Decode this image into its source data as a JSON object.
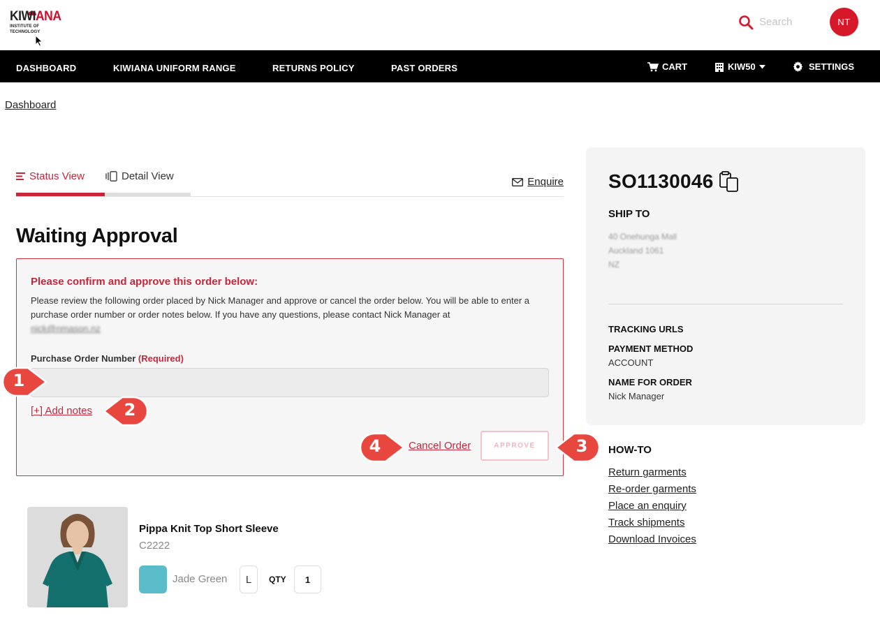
{
  "logo": {
    "brand_prefix": "KIWI",
    "brand_suffix": "ANA",
    "subtitle": "INSTITUTE OF TECHNOLOGY"
  },
  "header": {
    "search_placeholder": "Search",
    "avatar_initials": "NT"
  },
  "nav": {
    "items": [
      "DASHBOARD",
      "KIWIANA UNIFORM RANGE",
      "RETURNS POLICY",
      "PAST ORDERS"
    ],
    "cart": "CART",
    "account": "KIW50",
    "settings": "SETTINGS"
  },
  "breadcrumb": "Dashboard",
  "tabs": {
    "status": "Status View",
    "detail": "Detail View",
    "enquire": "Enquire"
  },
  "status_title": "Waiting Approval",
  "approval": {
    "heading": "Please confirm and approve this order below:",
    "body": "Please review the following order placed by Nick Manager and approve or cancel the order below. You will be able to enter a purchase order number or order notes below. If you have any questions, please contact Nick Manager at",
    "contact_email": "nick@nmason.nz",
    "po_label": "Purchase Order Number",
    "po_required": "(Required)",
    "po_value": "",
    "add_notes": "[+] Add notes",
    "cancel": "Cancel Order",
    "approve": "APPROVE"
  },
  "callouts": [
    "1",
    "2",
    "3",
    "4"
  ],
  "product": {
    "name": "Pippa Knit Top Short Sleeve",
    "code": "C2222",
    "color": "Jade Green",
    "color_hex": "#5bbcc9",
    "size": "L",
    "qty_label": "QTY",
    "qty": "1"
  },
  "side": {
    "order_number": "SO1130046",
    "ship_to_label": "SHIP TO",
    "address": [
      "40 Onehunga Mall",
      "Auckland 1061",
      "NZ"
    ],
    "tracking_label": "TRACKING URLS",
    "payment_label": "PAYMENT METHOD",
    "payment_value": "ACCOUNT",
    "name_label": "NAME FOR ORDER",
    "name_value": "Nick Manager"
  },
  "howto": {
    "title": "HOW-TO",
    "links": [
      "Return garments",
      "Re-order garments",
      "Place an enquiry",
      "Track shipments",
      "Download Invoices"
    ]
  },
  "colors": {
    "accent": "#c8253b",
    "nav_bg": "#000000",
    "avatar": "#d7182a",
    "callout": "#e8473f"
  }
}
